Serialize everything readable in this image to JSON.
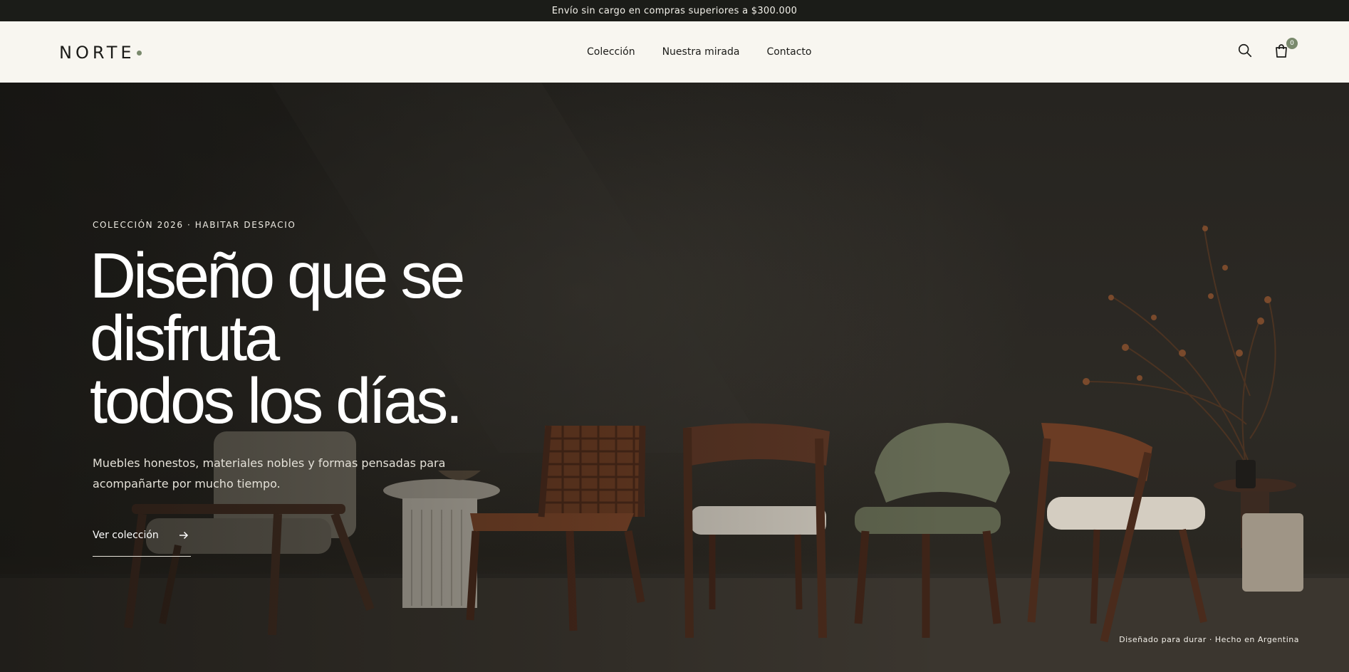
{
  "announcement": {
    "text": "Envío sin cargo en compras superiores a $300.000"
  },
  "header": {
    "logo": "NORTE",
    "nav": [
      {
        "label": "Colección"
      },
      {
        "label": "Nuestra mirada"
      },
      {
        "label": "Contacto"
      }
    ],
    "search_icon": "search-icon",
    "cart_icon": "shopping-bag-icon",
    "cart_count": "0"
  },
  "hero": {
    "eyebrow": "COLECCIÓN 2026 · HABITAR DESPACIO",
    "headline": [
      "Diseño que se",
      "disfruta",
      "todos los días."
    ],
    "subtitle": "Muebles honestos, materiales nobles y formas pensadas para acompañarte por mucho tiempo.",
    "cta_label": "Ver colección",
    "cta_icon": "arrow-right-icon",
    "footnote": "Diseñado para durar · Hecho en Argentina"
  },
  "colors": {
    "accent": "#7a8a6d",
    "header_bg": "#f8f6f0",
    "announcement_bg": "#1b1c18"
  }
}
